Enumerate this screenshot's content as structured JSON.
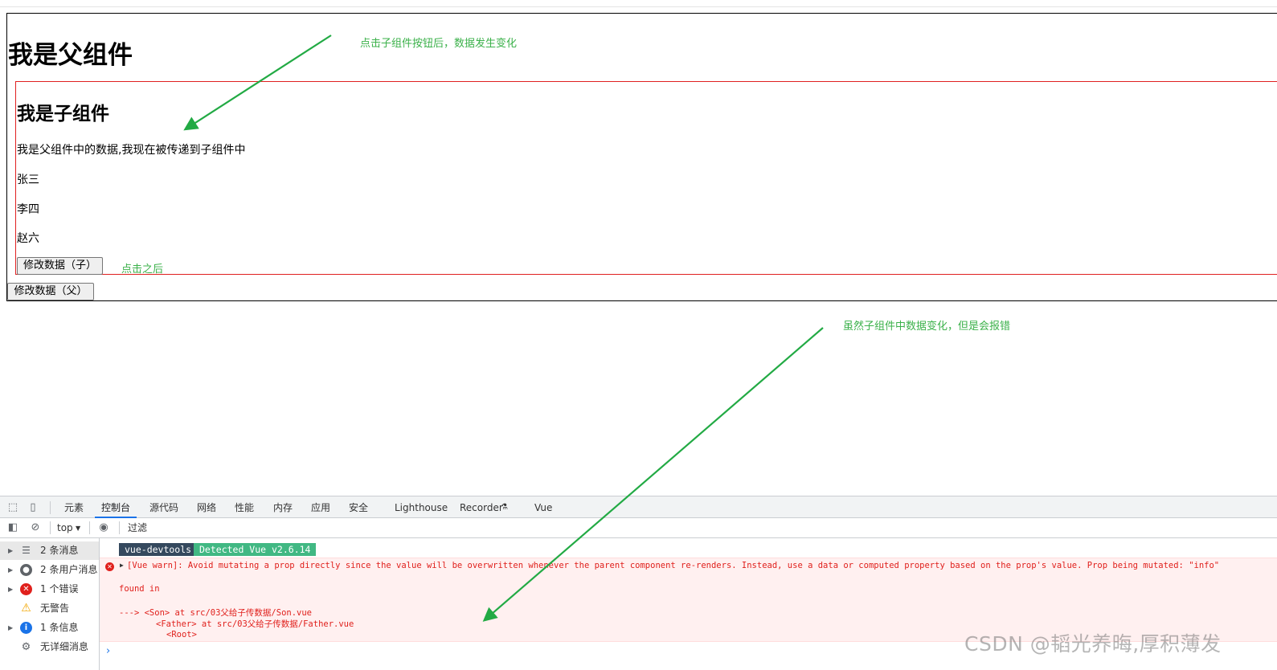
{
  "father": {
    "title": "我是父组件",
    "button_label": "修改数据（父）"
  },
  "son": {
    "title": "我是子组件",
    "message": "我是父组件中的数据,我现在被传递到子组件中",
    "names": [
      "张三",
      "李四",
      "赵六"
    ],
    "button_label": "修改数据（子）"
  },
  "annotations": {
    "top_note": "点击子组件按钮后，数据发生变化",
    "after_click": "点击之后",
    "bottom_note": "虽然子组件中数据变化，但是会报错",
    "arrow_color": "#22aa44"
  },
  "devtools": {
    "tabs": [
      "元素",
      "控制台",
      "源代码",
      "网络",
      "性能",
      "内存",
      "应用",
      "安全",
      "Lighthouse",
      "Recorder",
      "Vue"
    ],
    "active_tab": "控制台",
    "context_select": "top",
    "filter_placeholder": "过滤",
    "sidebar": [
      {
        "label": "2 条消息",
        "icon": "list-icon"
      },
      {
        "label": "2 条用户消息",
        "icon": "user-icon"
      },
      {
        "label": "1 个错误",
        "icon": "error-icon"
      },
      {
        "label": "无警告",
        "icon": "warning-icon"
      },
      {
        "label": "1 条信息",
        "icon": "info-icon"
      },
      {
        "label": "无详细消息",
        "icon": "gear-icon"
      }
    ],
    "badge_left": "vue-devtools",
    "badge_right": "Detected Vue v2.6.14",
    "error": {
      "line1": "[Vue warn]: Avoid mutating a prop directly since the value will be overwritten whenever the parent component re-renders. Instead, use a data or computed property based on the prop's value. Prop being mutated: \"info\"",
      "line2": "found in",
      "line3": "---> <Son> at src/03父给子传数据/Son.vue",
      "line4": "<Father> at src/03父给子传数据/Father.vue",
      "line5": "<Root>"
    },
    "prompt": "›"
  },
  "watermark": "CSDN @韬光养晦,厚积薄发"
}
